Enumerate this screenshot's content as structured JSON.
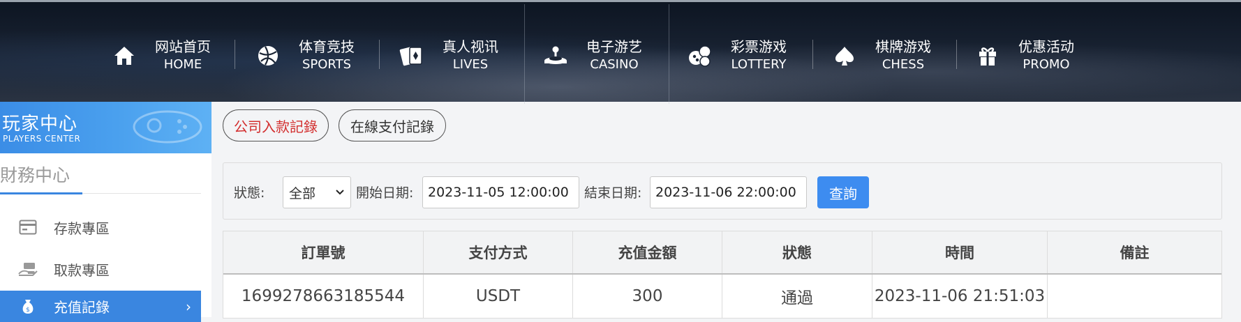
{
  "nav": [
    {
      "cn": "网站首页",
      "en": "HOME",
      "icon": "home-icon"
    },
    {
      "cn": "体育竞技",
      "en": "SPORTS",
      "icon": "basketball-icon"
    },
    {
      "cn": "真人视讯",
      "en": "LIVES",
      "icon": "cards-icon"
    },
    {
      "cn": "电子游艺",
      "en": "CASINO",
      "icon": "joystick-icon"
    },
    {
      "cn": "彩票游戏",
      "en": "LOTTERY",
      "icon": "lottery-balls-icon"
    },
    {
      "cn": "棋牌游戏",
      "en": "CHESS",
      "icon": "spade-icon"
    },
    {
      "cn": "优惠活动",
      "en": "PROMO",
      "icon": "gift-icon"
    }
  ],
  "sidebar": {
    "header_cn": "玩家中心",
    "header_en": "PLAYERS CENTER",
    "section_title": "財務中心",
    "items": [
      {
        "label": "存款專區",
        "icon": "card-icon"
      },
      {
        "label": "取款專區",
        "icon": "hand-money-icon"
      },
      {
        "label": "充值記錄",
        "icon": "money-bag-icon",
        "active": true
      }
    ],
    "active_color": "#3a86e0"
  },
  "tabs": [
    {
      "label": "公司入款記錄",
      "active": true
    },
    {
      "label": "在線支付記錄",
      "active": false
    }
  ],
  "filter": {
    "status_label": "狀態:",
    "status_value": "全部",
    "start_label": "開始日期:",
    "start_value": "2023-11-05 12:00:00",
    "end_label": "結束日期:",
    "end_value": "2023-11-06 22:00:00",
    "query_label": "查詢"
  },
  "table": {
    "headers": [
      "訂單號",
      "支付方式",
      "充值金額",
      "狀態",
      "時間",
      "備註"
    ],
    "rows": [
      [
        "1699278663185544",
        "USDT",
        "300",
        "通過",
        "2023-11-06 21:51:03",
        ""
      ]
    ]
  },
  "colors": {
    "accent": "#3d8cf0",
    "active_tab_text": "#d32f2f"
  }
}
